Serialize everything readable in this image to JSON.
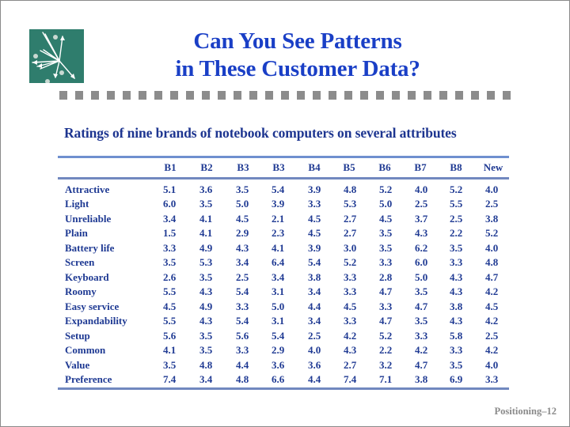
{
  "slide": {
    "title_line1": "Can You See Patterns",
    "title_line2": "in These Customer Data?",
    "subtitle": "Ratings of nine brands of notebook computers on several attributes",
    "footer": "Positioning–12",
    "logo_icon": "vector-map-logo-icon",
    "colors": {
      "title": "#1a3fc6",
      "text": "#1f3a93",
      "rule": "#6f8fcf",
      "logo_bg": "#2f7d6d",
      "separator": "#8c8c8c",
      "footer": "#8a8a8a"
    }
  },
  "table": {
    "columns": [
      "B1",
      "B2",
      "B3",
      "B3",
      "B4",
      "B5",
      "B6",
      "B7",
      "B8",
      "New"
    ],
    "rows": [
      {
        "label": "Attractive",
        "values": [
          "5.1",
          "3.6",
          "3.5",
          "5.4",
          "3.9",
          "4.8",
          "5.2",
          "4.0",
          "5.2",
          "4.0"
        ]
      },
      {
        "label": "Light",
        "values": [
          "6.0",
          "3.5",
          "5.0",
          "3.9",
          "3.3",
          "5.3",
          "5.0",
          "2.5",
          "5.5",
          "2.5"
        ]
      },
      {
        "label": "Unreliable",
        "values": [
          "3.4",
          "4.1",
          "4.5",
          "2.1",
          "4.5",
          "2.7",
          "4.5",
          "3.7",
          "2.5",
          "3.8"
        ]
      },
      {
        "label": "Plain",
        "values": [
          "1.5",
          "4.1",
          "2.9",
          "2.3",
          "4.5",
          "2.7",
          "3.5",
          "4.3",
          "2.2",
          "5.2"
        ]
      },
      {
        "label": "Battery life",
        "values": [
          "3.3",
          "4.9",
          "4.3",
          "4.1",
          "3.9",
          "3.0",
          "3.5",
          "6.2",
          "3.5",
          "4.0"
        ]
      },
      {
        "label": "Screen",
        "values": [
          "3.5",
          "5.3",
          "3.4",
          "6.4",
          "5.4",
          "5.2",
          "3.3",
          "6.0",
          "3.3",
          "4.8"
        ]
      },
      {
        "label": "Keyboard",
        "values": [
          "2.6",
          "3.5",
          "2.5",
          "3.4",
          "3.8",
          "3.3",
          "2.8",
          "5.0",
          "4.3",
          "4.7"
        ]
      },
      {
        "label": "Roomy",
        "values": [
          "5.5",
          "4.3",
          "5.4",
          "3.1",
          "3.4",
          "3.3",
          "4.7",
          "3.5",
          "4.3",
          "4.2"
        ]
      },
      {
        "label": "Easy service",
        "values": [
          "4.5",
          "4.9",
          "3.3",
          "5.0",
          "4.4",
          "4.5",
          "3.3",
          "4.7",
          "3.8",
          "4.5"
        ]
      },
      {
        "label": "Expandability",
        "values": [
          "5.5",
          "4.3",
          "5.4",
          "3.1",
          "3.4",
          "3.3",
          "4.7",
          "3.5",
          "4.3",
          "4.2"
        ]
      },
      {
        "label": "Setup",
        "values": [
          "5.6",
          "3.5",
          "5.6",
          "5.4",
          "2.5",
          "4.2",
          "5.2",
          "3.3",
          "5.8",
          "2.5"
        ]
      },
      {
        "label": "Common",
        "values": [
          "4.1",
          "3.5",
          "3.3",
          "2.9",
          "4.0",
          "4.3",
          "2.2",
          "4.2",
          "3.3",
          "4.2"
        ]
      },
      {
        "label": "Value",
        "values": [
          "3.5",
          "4.8",
          "4.4",
          "3.6",
          "3.6",
          "2.7",
          "3.2",
          "4.7",
          "3.5",
          "4.0"
        ]
      },
      {
        "label": "Preference",
        "values": [
          "7.4",
          "3.4",
          "4.8",
          "6.6",
          "4.4",
          "7.4",
          "7.1",
          "3.8",
          "6.9",
          "3.3"
        ]
      }
    ]
  }
}
